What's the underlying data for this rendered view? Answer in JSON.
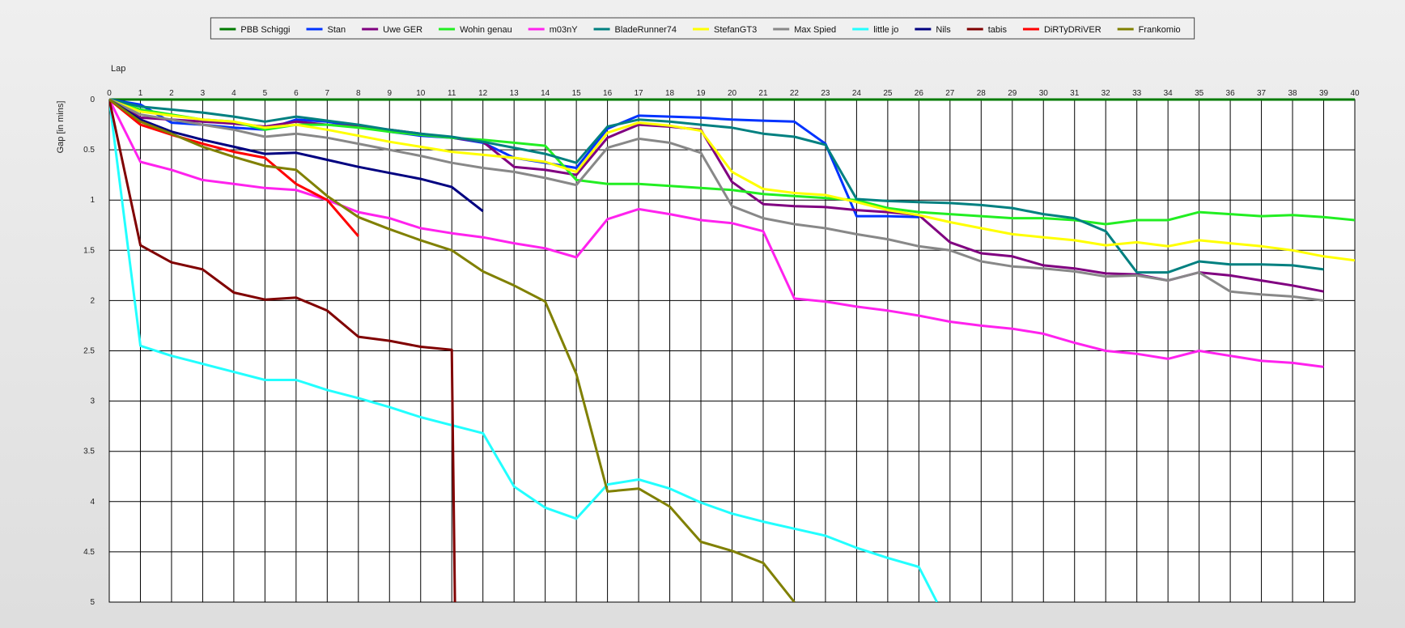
{
  "chart_data": {
    "type": "line",
    "xlabel": "Lap",
    "ylabel": "Gap [in mins]",
    "xlim": [
      0,
      40
    ],
    "ylim": [
      0,
      5
    ],
    "y_inverted": true,
    "x_ticks": [
      0,
      1,
      2,
      3,
      4,
      5,
      6,
      7,
      8,
      9,
      10,
      11,
      12,
      13,
      14,
      15,
      16,
      17,
      18,
      19,
      20,
      21,
      22,
      23,
      24,
      25,
      26,
      27,
      28,
      29,
      30,
      31,
      32,
      33,
      34,
      35,
      36,
      37,
      38,
      39,
      40
    ],
    "y_ticks": [
      0,
      0.5,
      1,
      1.5,
      2,
      2.5,
      3,
      3.5,
      4,
      4.5,
      5
    ],
    "y_tick_labels": [
      "0",
      "0.5",
      "1",
      "1.5",
      "2",
      "2.5",
      "3",
      "3.5",
      "4",
      "4.5",
      "5"
    ],
    "grid": true,
    "legend_position": "top-center",
    "series": [
      {
        "name": "PBB Schiggi",
        "color": "#007a00",
        "x": [
          0,
          40
        ],
        "y": [
          0,
          0
        ]
      },
      {
        "name": "Stan",
        "color": "#0033ff",
        "x": [
          0,
          1,
          2,
          3,
          4,
          5,
          6,
          7,
          8,
          9,
          10,
          11,
          12,
          13,
          14,
          15,
          16,
          17,
          18,
          19,
          20,
          21,
          22,
          23,
          24,
          25,
          26
        ],
        "y": [
          0,
          0.05,
          0.23,
          0.25,
          0.28,
          0.3,
          0.2,
          0.22,
          0.27,
          0.32,
          0.36,
          0.38,
          0.43,
          0.58,
          0.63,
          0.68,
          0.29,
          0.16,
          0.17,
          0.18,
          0.2,
          0.21,
          0.22,
          0.44,
          1.16,
          1.16,
          1.17
        ]
      },
      {
        "name": "Uwe GER",
        "color": "#800080",
        "x": [
          0,
          1,
          2,
          3,
          4,
          5,
          6,
          7,
          8,
          9,
          10,
          11,
          12,
          13,
          14,
          15,
          16,
          17,
          18,
          19,
          20,
          21,
          22,
          23,
          24,
          25,
          26,
          27,
          28,
          29,
          30,
          31,
          32,
          33,
          34,
          35,
          36,
          37,
          38,
          39
        ],
        "y": [
          0,
          0.18,
          0.2,
          0.22,
          0.24,
          0.27,
          0.22,
          0.25,
          0.27,
          0.3,
          0.34,
          0.38,
          0.42,
          0.67,
          0.7,
          0.75,
          0.38,
          0.25,
          0.27,
          0.3,
          0.82,
          1.04,
          1.06,
          1.07,
          1.1,
          1.12,
          1.15,
          1.42,
          1.53,
          1.56,
          1.65,
          1.68,
          1.73,
          1.74,
          1.8,
          1.72,
          1.75,
          1.8,
          1.85,
          1.91
        ]
      },
      {
        "name": "Wohin genau",
        "color": "#22ee22",
        "x": [
          0,
          1,
          2,
          3,
          4,
          5,
          6,
          7,
          8,
          9,
          10,
          11,
          12,
          13,
          14,
          15,
          16,
          17,
          18,
          19,
          20,
          21,
          22,
          23,
          24,
          25,
          26,
          27,
          28,
          29,
          30,
          31,
          32,
          33,
          34,
          35,
          36,
          37,
          38,
          39,
          40
        ],
        "y": [
          0,
          0.1,
          0.15,
          0.2,
          0.22,
          0.3,
          0.25,
          0.25,
          0.28,
          0.32,
          0.35,
          0.38,
          0.4,
          0.43,
          0.46,
          0.8,
          0.84,
          0.84,
          0.86,
          0.88,
          0.9,
          0.94,
          0.96,
          0.98,
          1.0,
          1.08,
          1.12,
          1.14,
          1.16,
          1.18,
          1.18,
          1.2,
          1.24,
          1.2,
          1.2,
          1.12,
          1.14,
          1.16,
          1.15,
          1.17,
          1.2
        ]
      },
      {
        "name": "m03nY",
        "color": "#ff22ee",
        "x": [
          0,
          1,
          2,
          3,
          4,
          5,
          6,
          7,
          8,
          9,
          10,
          11,
          12,
          13,
          14,
          15,
          16,
          17,
          18,
          19,
          20,
          21,
          22,
          23,
          24,
          25,
          26,
          27,
          28,
          29,
          30,
          31,
          32,
          33,
          34,
          35,
          36,
          37,
          38,
          39
        ],
        "y": [
          0,
          0.62,
          0.7,
          0.8,
          0.84,
          0.88,
          0.9,
          1.0,
          1.12,
          1.18,
          1.28,
          1.33,
          1.37,
          1.43,
          1.48,
          1.57,
          1.19,
          1.09,
          1.14,
          1.2,
          1.23,
          1.31,
          1.98,
          2.01,
          2.06,
          2.1,
          2.15,
          2.21,
          2.25,
          2.28,
          2.33,
          2.42,
          2.5,
          2.53,
          2.58,
          2.5,
          2.55,
          2.6,
          2.62,
          2.66
        ]
      },
      {
        "name": "BladeRunner74",
        "color": "#008080",
        "x": [
          0,
          1,
          2,
          3,
          4,
          5,
          6,
          7,
          8,
          9,
          10,
          11,
          12,
          13,
          14,
          15,
          16,
          17,
          18,
          19,
          20,
          21,
          22,
          23,
          24,
          25,
          26,
          27,
          28,
          29,
          30,
          31,
          32,
          33,
          34,
          35,
          36,
          37,
          38,
          39
        ],
        "y": [
          0,
          0.07,
          0.1,
          0.13,
          0.17,
          0.22,
          0.17,
          0.21,
          0.25,
          0.3,
          0.34,
          0.37,
          0.42,
          0.48,
          0.54,
          0.63,
          0.27,
          0.2,
          0.22,
          0.25,
          0.28,
          0.34,
          0.37,
          0.45,
          0.99,
          1.01,
          1.02,
          1.03,
          1.05,
          1.08,
          1.14,
          1.18,
          1.31,
          1.72,
          1.72,
          1.61,
          1.64,
          1.64,
          1.65,
          1.69
        ]
      },
      {
        "name": "StefanGT3",
        "color": "#ffff00",
        "x": [
          0,
          1,
          2,
          3,
          4,
          5,
          6,
          7,
          8,
          9,
          10,
          11,
          12,
          13,
          14,
          15,
          16,
          17,
          18,
          19,
          20,
          21,
          22,
          23,
          24,
          25,
          26,
          27,
          28,
          29,
          30,
          31,
          32,
          33,
          34,
          35,
          36,
          37,
          38,
          39,
          40
        ],
        "y": [
          0,
          0.12,
          0.16,
          0.2,
          0.22,
          0.28,
          0.25,
          0.3,
          0.36,
          0.42,
          0.47,
          0.52,
          0.55,
          0.58,
          0.62,
          0.72,
          0.33,
          0.23,
          0.26,
          0.31,
          0.72,
          0.89,
          0.93,
          0.95,
          1.02,
          1.1,
          1.15,
          1.22,
          1.28,
          1.34,
          1.37,
          1.4,
          1.45,
          1.42,
          1.46,
          1.4,
          1.43,
          1.46,
          1.5,
          1.56,
          1.6
        ]
      },
      {
        "name": "Max Spied",
        "color": "#888888",
        "x": [
          0,
          1,
          2,
          3,
          4,
          5,
          6,
          7,
          8,
          9,
          10,
          11,
          12,
          13,
          14,
          15,
          16,
          17,
          18,
          19,
          20,
          21,
          22,
          23,
          24,
          25,
          26,
          27,
          28,
          29,
          30,
          31,
          32,
          33,
          34,
          35,
          36,
          37,
          38,
          39
        ],
        "y": [
          0,
          0.15,
          0.2,
          0.25,
          0.3,
          0.37,
          0.34,
          0.38,
          0.44,
          0.5,
          0.56,
          0.63,
          0.68,
          0.72,
          0.78,
          0.85,
          0.48,
          0.39,
          0.43,
          0.53,
          1.06,
          1.18,
          1.24,
          1.28,
          1.34,
          1.39,
          1.46,
          1.5,
          1.61,
          1.66,
          1.68,
          1.71,
          1.76,
          1.75,
          1.8,
          1.72,
          1.91,
          1.94,
          1.96,
          2.0
        ]
      },
      {
        "name": "little jo",
        "color": "#22ffff",
        "x": [
          0,
          1,
          2,
          3,
          4,
          5,
          6,
          7,
          8,
          9,
          10,
          11,
          12,
          13,
          14,
          15,
          16,
          17,
          18,
          19,
          20,
          21,
          22,
          23,
          24,
          25,
          26,
          26.58
        ],
        "y": [
          0,
          2.45,
          2.55,
          2.63,
          2.71,
          2.79,
          2.79,
          2.89,
          2.97,
          3.06,
          3.16,
          3.24,
          3.32,
          3.85,
          4.06,
          4.17,
          3.83,
          3.78,
          3.87,
          4.01,
          4.12,
          4.2,
          4.27,
          4.34,
          4.46,
          4.56,
          4.65,
          5.0
        ]
      },
      {
        "name": "Nils",
        "color": "#000080",
        "x": [
          0,
          1,
          2,
          3,
          4,
          5,
          6,
          7,
          8,
          9,
          10,
          11,
          12
        ],
        "y": [
          0,
          0.2,
          0.32,
          0.4,
          0.47,
          0.54,
          0.53,
          0.6,
          0.67,
          0.73,
          0.79,
          0.87,
          1.11
        ]
      },
      {
        "name": "tabis",
        "color": "#800000",
        "x": [
          0,
          1,
          2,
          3,
          4,
          5,
          6,
          7,
          8,
          9,
          10,
          11,
          11.1
        ],
        "y": [
          0,
          1.45,
          1.62,
          1.69,
          1.92,
          1.99,
          1.97,
          2.1,
          2.36,
          2.4,
          2.46,
          2.49,
          5.0
        ]
      },
      {
        "name": "DiRTyDRiVER",
        "color": "#ff0000",
        "x": [
          0,
          1,
          2,
          3,
          4,
          5,
          6,
          7,
          8
        ],
        "y": [
          0,
          0.25,
          0.35,
          0.44,
          0.52,
          0.58,
          0.84,
          1.0,
          1.36
        ]
      },
      {
        "name": "Frankomio",
        "color": "#808000",
        "x": [
          0,
          1,
          2,
          3,
          4,
          5,
          6,
          7,
          8,
          9,
          10,
          11,
          12,
          13,
          14,
          15,
          16,
          17,
          18,
          19,
          20,
          21,
          22
        ],
        "y": [
          0,
          0.22,
          0.34,
          0.47,
          0.57,
          0.66,
          0.7,
          0.96,
          1.17,
          1.29,
          1.4,
          1.5,
          1.71,
          1.85,
          2.01,
          2.73,
          3.9,
          3.87,
          4.05,
          4.4,
          4.49,
          4.61,
          5.0
        ]
      }
    ]
  }
}
